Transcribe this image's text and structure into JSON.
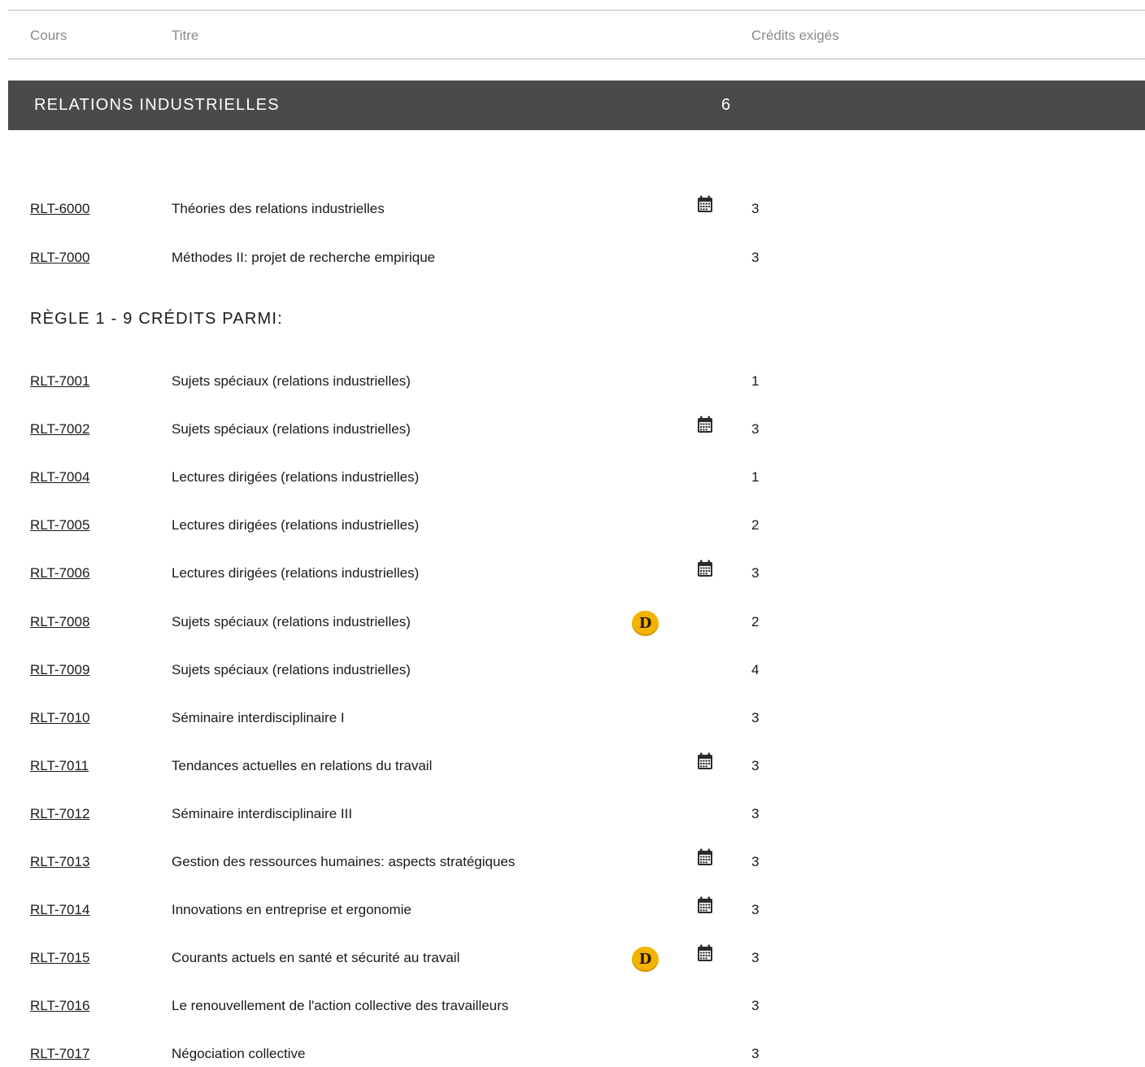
{
  "table_header": {
    "cours": "Cours",
    "titre": "Titre",
    "credits": "Crédits exigés"
  },
  "section": {
    "title": "RELATIONS INDUSTRIELLES",
    "credits": "6"
  },
  "rule": {
    "heading": "RÈGLE 1 - 9 CRÉDITS PARMI:"
  },
  "colors": {
    "section_bar": "#4a4a4a",
    "d_badge": "#f3b300",
    "divider": "#b8b8b8"
  },
  "icons": {
    "calendar": "calendar-icon",
    "d_badge": "d-badge-icon"
  },
  "required_courses": [
    {
      "code": "RLT-6000",
      "title": "Théories des relations industrielles",
      "credits": "3",
      "d": false,
      "cal": true
    },
    {
      "code": "RLT-7000",
      "title": "Méthodes II: projet de recherche empirique",
      "credits": "3",
      "d": false,
      "cal": false
    }
  ],
  "rule_courses": [
    {
      "code": "RLT-7001",
      "title": "Sujets spéciaux (relations industrielles)",
      "credits": "1",
      "d": false,
      "cal": false
    },
    {
      "code": "RLT-7002",
      "title": "Sujets spéciaux (relations industrielles)",
      "credits": "3",
      "d": false,
      "cal": true
    },
    {
      "code": "RLT-7004",
      "title": "Lectures dirigées (relations industrielles)",
      "credits": "1",
      "d": false,
      "cal": false
    },
    {
      "code": "RLT-7005",
      "title": "Lectures dirigées (relations industrielles)",
      "credits": "2",
      "d": false,
      "cal": false
    },
    {
      "code": "RLT-7006",
      "title": "Lectures dirigées (relations industrielles)",
      "credits": "3",
      "d": false,
      "cal": true
    },
    {
      "code": "RLT-7008",
      "title": "Sujets spéciaux (relations industrielles)",
      "credits": "2",
      "d": true,
      "cal": false
    },
    {
      "code": "RLT-7009",
      "title": "Sujets spéciaux (relations industrielles)",
      "credits": "4",
      "d": false,
      "cal": false
    },
    {
      "code": "RLT-7010",
      "title": "Séminaire interdisciplinaire I",
      "credits": "3",
      "d": false,
      "cal": false
    },
    {
      "code": "RLT-7011",
      "title": "Tendances actuelles en relations du travail",
      "credits": "3",
      "d": false,
      "cal": true
    },
    {
      "code": "RLT-7012",
      "title": "Séminaire interdisciplinaire III",
      "credits": "3",
      "d": false,
      "cal": false
    },
    {
      "code": "RLT-7013",
      "title": "Gestion des ressources humaines: aspects stratégiques",
      "credits": "3",
      "d": false,
      "cal": true
    },
    {
      "code": "RLT-7014",
      "title": "Innovations en entreprise et ergonomie",
      "credits": "3",
      "d": false,
      "cal": true
    },
    {
      "code": "RLT-7015",
      "title": "Courants actuels en santé et sécurité au travail",
      "credits": "3",
      "d": true,
      "cal": true
    },
    {
      "code": "RLT-7016",
      "title": "Le renouvellement de l'action collective des travailleurs",
      "credits": "3",
      "d": false,
      "cal": false
    },
    {
      "code": "RLT-7017",
      "title": "Négociation collective",
      "credits": "3",
      "d": false,
      "cal": false
    }
  ]
}
